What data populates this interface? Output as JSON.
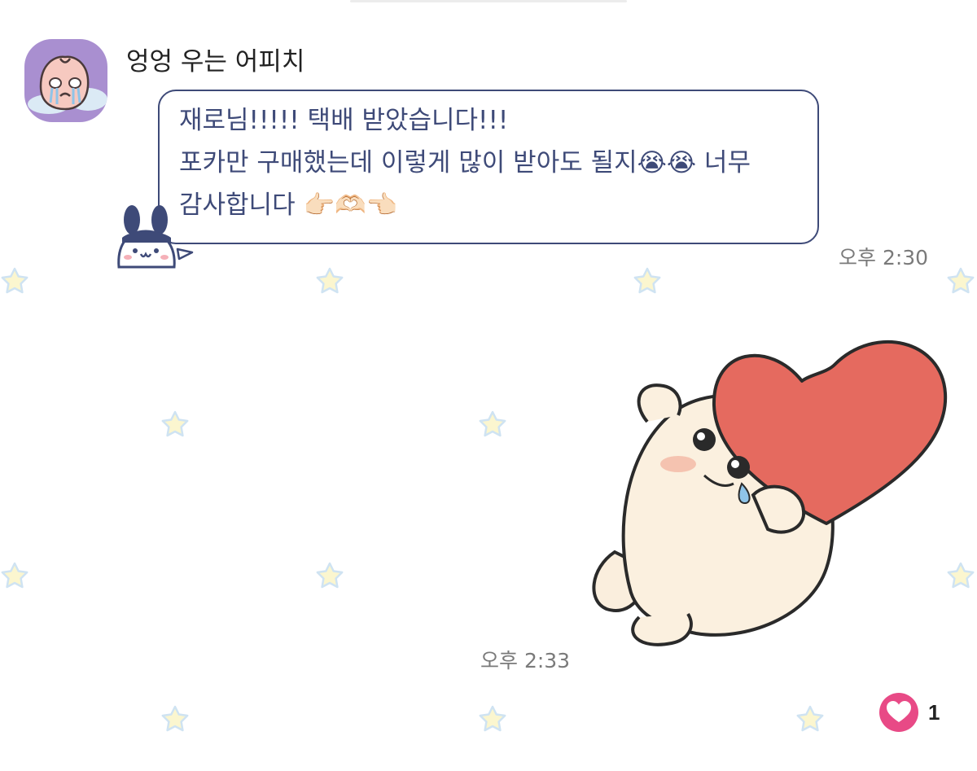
{
  "chat": {
    "sender_name": "엉엉 우는 어피치",
    "message_lines": [
      "재로님!!!!! 택배 받았습니다!!!",
      "포카만 구매했는데 이렇게 많이 받아도 될지😭😭 너무",
      "감사합니다 👉🏻🫶🏻👈🏻"
    ],
    "message_time": "오후 2:30",
    "sticker_time": "오후 2:33",
    "reaction": {
      "icon": "heart-icon",
      "count": "1",
      "color": "#e84a86"
    }
  },
  "colors": {
    "bubble_border": "#3e4a78",
    "text_primary": "#3e4a78",
    "avatar_bg": "#a98fd0",
    "star_fill": "#fbf6cf",
    "star_stroke": "#cfe3f2",
    "heart": "#e56a5f"
  }
}
